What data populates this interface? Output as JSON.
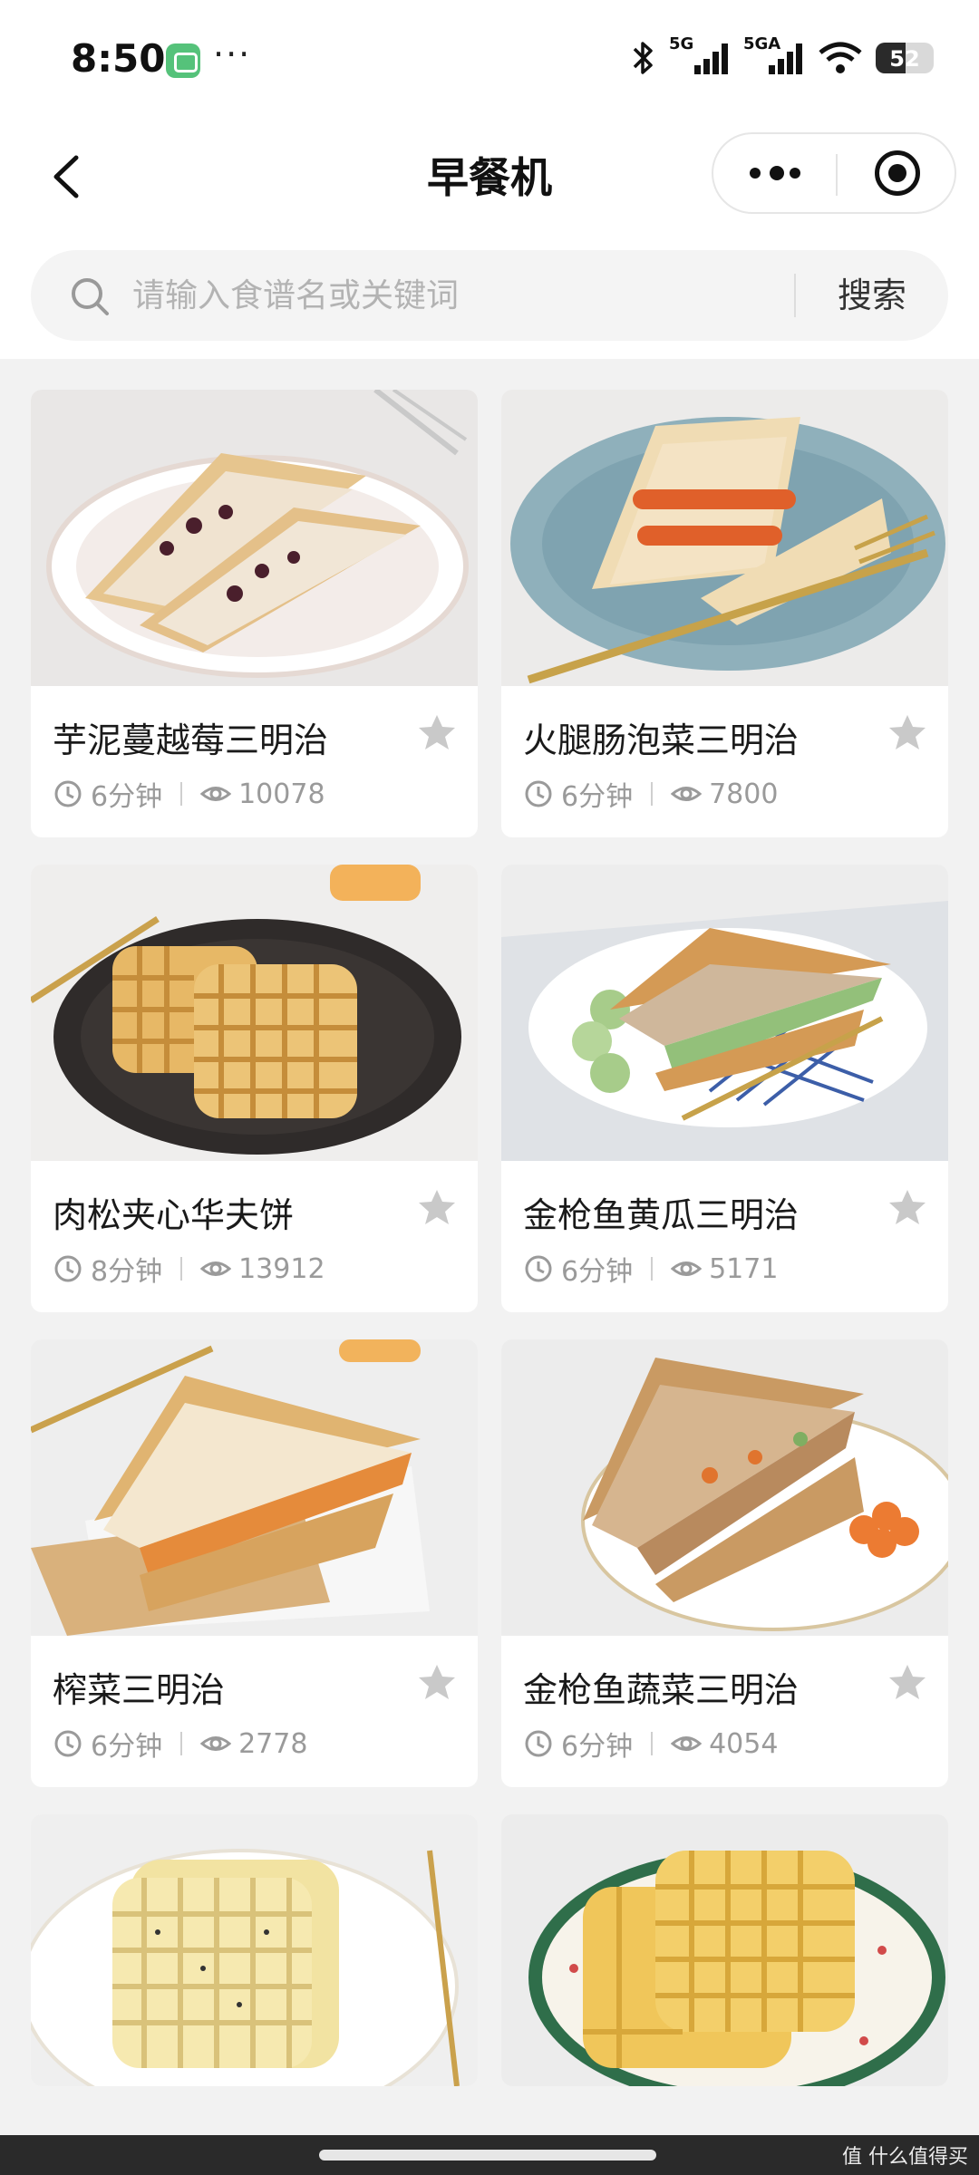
{
  "status_bar": {
    "time": "8:50",
    "dots": "···",
    "signal1_label": "5G",
    "signal2_label": "5GA",
    "battery": "52",
    "battery_level": 0.52
  },
  "header": {
    "title": "早餐机"
  },
  "search": {
    "placeholder": "请输入食谱名或关键词",
    "button_label": "搜索"
  },
  "recipes": [
    {
      "title": "芋泥蔓越莓三明治",
      "time": "6分钟",
      "views": "10078",
      "image": "sandwich-plate"
    },
    {
      "title": "火腿肠泡菜三明治",
      "time": "6分钟",
      "views": "7800",
      "image": "sausage-sandwich"
    },
    {
      "title": "肉松夹心华夫饼",
      "time": "8分钟",
      "views": "13912",
      "image": "waffle-dark-plate"
    },
    {
      "title": "金枪鱼黄瓜三明治",
      "time": "6分钟",
      "views": "5171",
      "image": "tuna-cucumber-sandwich"
    },
    {
      "title": "榨菜三明治",
      "time": "6分钟",
      "views": "2778",
      "image": "sandwich-paper"
    },
    {
      "title": "金枪鱼蔬菜三明治",
      "time": "6分钟",
      "views": "4054",
      "image": "tuna-veg-sandwich"
    },
    {
      "title": "",
      "time": "",
      "views": "",
      "image": "waffle-herb"
    },
    {
      "title": "",
      "time": "",
      "views": "",
      "image": "waffle-floral-plate"
    }
  ],
  "footer": {
    "watermark": "值 什么值得买"
  },
  "colors": {
    "page_bg": "#f2f2f2",
    "card_bg": "#ffffff",
    "meta_text": "#9a9a9a",
    "star": "#c9c9c9",
    "badge": "#55c27a"
  }
}
